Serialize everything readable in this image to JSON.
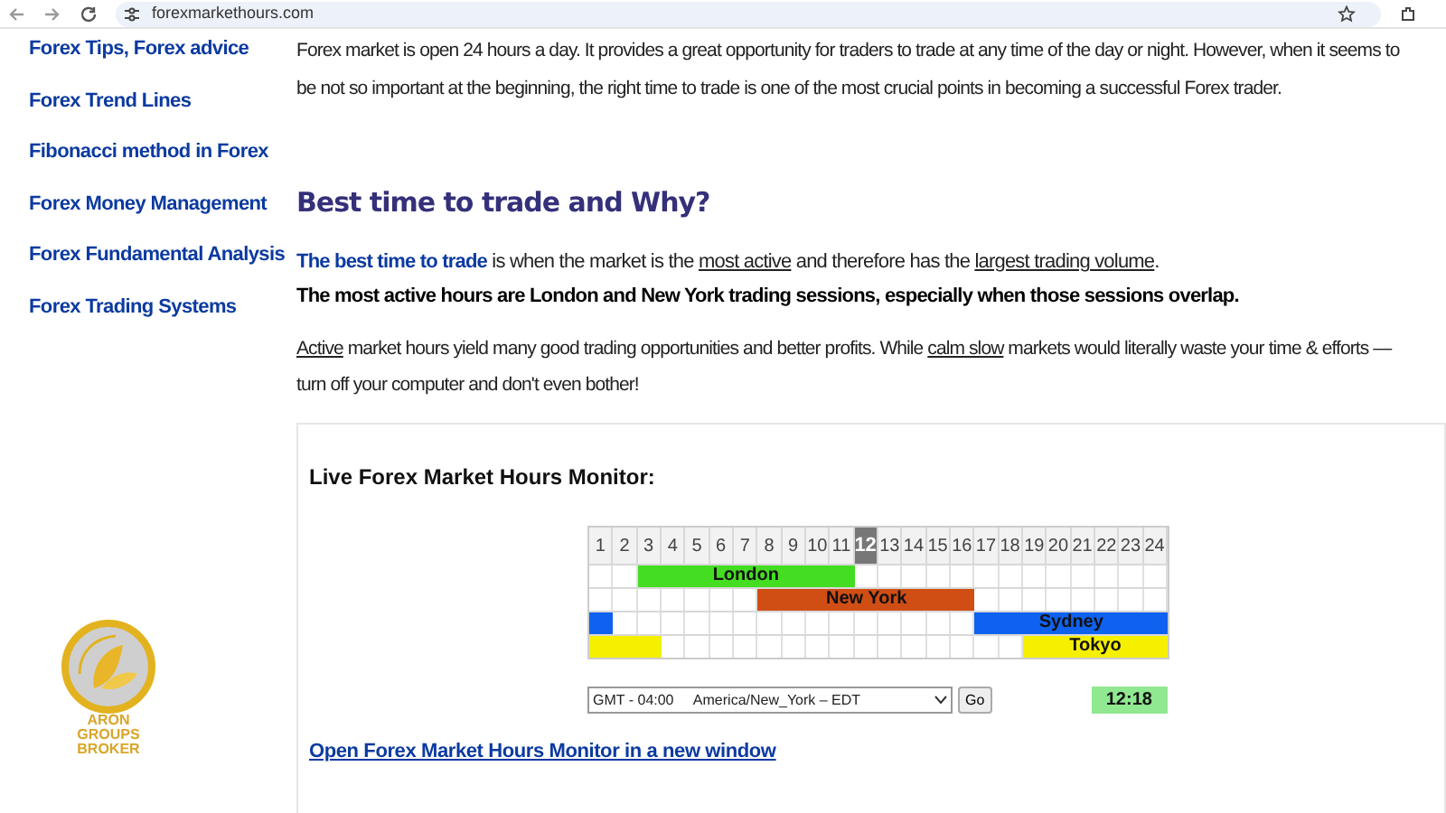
{
  "browser": {
    "url": "forexmarkethours.com"
  },
  "sidebar": {
    "items": [
      {
        "label": "Forex Tips, Forex advice"
      },
      {
        "label": "Forex Trend Lines"
      },
      {
        "label": "Fibonacci method in Forex"
      },
      {
        "label": "Forex Money Management"
      },
      {
        "label": "Forex Fundamental Analysis"
      },
      {
        "label": "Forex Trading Systems"
      }
    ],
    "logo": {
      "lines": [
        "ARON",
        "GROUPS",
        "BROKER"
      ]
    }
  },
  "intro": [
    "Forex market is open 24 hours a day. It provides a great opportunity for traders to trade at any time of the day or night. However, when it seems to",
    "be not so important at the beginning, the right time to trade is one of the most crucial points in becoming a successful Forex trader."
  ],
  "heading": "Best time to trade and Why?",
  "paragraph_1": {
    "link": "The best time to trade",
    "text": [
      " is when the market is the ",
      "most active",
      " and therefore has the ",
      "largest trading volume",
      "."
    ],
    "bold_line": "The most active hours are London and New York trading sessions, especially when those sessions overlap."
  },
  "paragraph_2": {
    "text": [
      "Active",
      " market hours yield many good trading opportunities and better profits. While ",
      "calm slow",
      " markets would literally waste your time & efforts —"
    ],
    "line_2": "turn off your computer and don't even bother!"
  },
  "monitor": {
    "title": "Live Forex Market Hours Monitor:",
    "hours": [
      {
        "label": "1",
        "selected": false
      },
      {
        "label": "2",
        "selected": false
      },
      {
        "label": "3",
        "selected": false
      },
      {
        "label": "4",
        "selected": false
      },
      {
        "label": "5",
        "selected": false
      },
      {
        "label": "6",
        "selected": false
      },
      {
        "label": "7",
        "selected": false
      },
      {
        "label": "8",
        "selected": false
      },
      {
        "label": "9",
        "selected": false
      },
      {
        "label": "10",
        "selected": false
      },
      {
        "label": "11",
        "selected": false
      },
      {
        "label": "12",
        "selected": true
      },
      {
        "label": "13",
        "selected": false
      },
      {
        "label": "14",
        "selected": false
      },
      {
        "label": "15",
        "selected": false
      },
      {
        "label": "16",
        "selected": false
      },
      {
        "label": "17",
        "selected": false
      },
      {
        "label": "18",
        "selected": false
      },
      {
        "label": "19",
        "selected": false
      },
      {
        "label": "20",
        "selected": false
      },
      {
        "label": "21",
        "selected": false
      },
      {
        "label": "22",
        "selected": false
      },
      {
        "label": "23",
        "selected": false
      },
      {
        "label": "24",
        "selected": false
      }
    ],
    "sessions": [
      {
        "name": "London",
        "color": "#44dd22",
        "cells": [
          {
            "on": false
          },
          {
            "on": false
          },
          {
            "on": true
          },
          {
            "on": true
          },
          {
            "on": true
          },
          {
            "on": true
          },
          {
            "on": true
          },
          {
            "on": true
          },
          {
            "on": true
          },
          {
            "on": true
          },
          {
            "on": true
          },
          {
            "on": false
          },
          {
            "on": false
          },
          {
            "on": false
          },
          {
            "on": false
          },
          {
            "on": false
          },
          {
            "on": false
          },
          {
            "on": false
          },
          {
            "on": false
          },
          {
            "on": false
          },
          {
            "on": false
          },
          {
            "on": false
          },
          {
            "on": false
          },
          {
            "on": false
          }
        ]
      },
      {
        "name": "New York",
        "color": "#d04e14",
        "cells": [
          {
            "on": false
          },
          {
            "on": false
          },
          {
            "on": false
          },
          {
            "on": false
          },
          {
            "on": false
          },
          {
            "on": false
          },
          {
            "on": false
          },
          {
            "on": true
          },
          {
            "on": true
          },
          {
            "on": true
          },
          {
            "on": true
          },
          {
            "on": true
          },
          {
            "on": true
          },
          {
            "on": true
          },
          {
            "on": true
          },
          {
            "on": true
          },
          {
            "on": false
          },
          {
            "on": false
          },
          {
            "on": false
          },
          {
            "on": false
          },
          {
            "on": false
          },
          {
            "on": false
          },
          {
            "on": false
          },
          {
            "on": false
          }
        ]
      },
      {
        "name": "Sydney",
        "color": "#0f62f0",
        "cells": [
          {
            "on": true
          },
          {
            "on": false
          },
          {
            "on": false
          },
          {
            "on": false
          },
          {
            "on": false
          },
          {
            "on": false
          },
          {
            "on": false
          },
          {
            "on": false
          },
          {
            "on": false
          },
          {
            "on": false
          },
          {
            "on": false
          },
          {
            "on": false
          },
          {
            "on": false
          },
          {
            "on": false
          },
          {
            "on": false
          },
          {
            "on": false
          },
          {
            "on": true
          },
          {
            "on": true
          },
          {
            "on": true
          },
          {
            "on": true
          },
          {
            "on": true
          },
          {
            "on": true
          },
          {
            "on": true
          },
          {
            "on": true
          }
        ]
      },
      {
        "name": "Tokyo",
        "color": "#f5f000",
        "cells": [
          {
            "on": true
          },
          {
            "on": true
          },
          {
            "on": true
          },
          {
            "on": false
          },
          {
            "on": false
          },
          {
            "on": false
          },
          {
            "on": false
          },
          {
            "on": false
          },
          {
            "on": false
          },
          {
            "on": false
          },
          {
            "on": false
          },
          {
            "on": false
          },
          {
            "on": false
          },
          {
            "on": false
          },
          {
            "on": false
          },
          {
            "on": false
          },
          {
            "on": false
          },
          {
            "on": false
          },
          {
            "on": true
          },
          {
            "on": true
          },
          {
            "on": true
          },
          {
            "on": true
          },
          {
            "on": true
          },
          {
            "on": true
          }
        ]
      }
    ],
    "timezone": "GMT - 04:00     America/New_York – EDT",
    "go_button": "Go",
    "clock": "12:18",
    "link": "Open Forex Market Hours Monitor in a new window"
  }
}
